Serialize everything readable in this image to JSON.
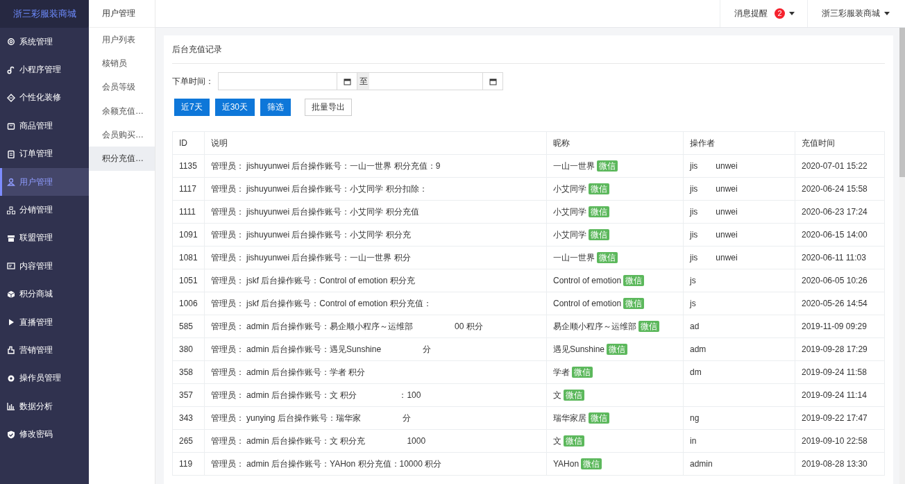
{
  "brand": "浙三彩服装商城",
  "sidebar": {
    "items": [
      {
        "label": "系统管理",
        "selected": false
      },
      {
        "label": "小程序管理",
        "selected": false
      },
      {
        "label": "个性化装修",
        "selected": false
      },
      {
        "label": "商品管理",
        "selected": false
      },
      {
        "label": "订单管理",
        "selected": false
      },
      {
        "label": "用户管理",
        "selected": true
      },
      {
        "label": "分销管理",
        "selected": false
      },
      {
        "label": "联盟管理",
        "selected": false
      },
      {
        "label": "内容管理",
        "selected": false
      },
      {
        "label": "积分商城",
        "selected": false
      },
      {
        "label": "直播管理",
        "selected": false
      },
      {
        "label": "营销管理",
        "selected": false
      },
      {
        "label": "操作员管理",
        "selected": false
      },
      {
        "label": "数据分析",
        "selected": false
      },
      {
        "label": "修改密码",
        "selected": false
      }
    ]
  },
  "submenu": {
    "title": "用户管理",
    "items": [
      {
        "label": "用户列表",
        "selected": false
      },
      {
        "label": "核销员",
        "selected": false
      },
      {
        "label": "会员等级",
        "selected": false
      },
      {
        "label": "余额充值…",
        "selected": false
      },
      {
        "label": "会员购买…",
        "selected": false
      },
      {
        "label": "积分充值…",
        "selected": true
      }
    ]
  },
  "topbar": {
    "notifications": {
      "label": "消息提醒",
      "count": "2"
    },
    "account": "浙三彩服装商城"
  },
  "card": {
    "title": "后台充值记录",
    "filter": {
      "label": "下单时间：",
      "separator": "至",
      "buttons": [
        {
          "label": "近7天",
          "kind": "primary"
        },
        {
          "label": "近30天",
          "kind": "primary"
        },
        {
          "label": "筛选",
          "kind": "primary"
        },
        {
          "label": "批量导出",
          "kind": "default"
        }
      ]
    },
    "table": {
      "columns": [
        "ID",
        "说明",
        "昵称",
        "操作者",
        "充值时间"
      ],
      "rows": [
        {
          "id": "1135",
          "desc": "管理员： jishuyunwei 后台操作账号：一山一世界 积分充值：9",
          "nickname": "一山一世界",
          "tag": "微信",
          "operator": [
            "jis",
            "unwei"
          ],
          "time": "2020-07-01 15:22"
        },
        {
          "id": "1117",
          "desc": "管理员： jishuyunwei 后台操作账号：小艾同学 积分扣除：",
          "nickname": "小艾同学",
          "tag": "微信",
          "operator": [
            "jis",
            "unwei"
          ],
          "time": "2020-06-24 15:58"
        },
        {
          "id": "1111",
          "desc": "管理员： jishuyunwei 后台操作账号：小艾同学 积分充值",
          "nickname": "小艾同学",
          "tag": "微信",
          "operator": [
            "jis",
            "unwei"
          ],
          "time": "2020-06-23 17:24"
        },
        {
          "id": "1091",
          "desc": "管理员： jishuyunwei 后台操作账号：小艾同学 积分充",
          "nickname": "小艾同学",
          "tag": "微信",
          "operator": [
            "jis",
            "unwei"
          ],
          "time": "2020-06-15 14:00"
        },
        {
          "id": "1081",
          "desc": "管理员： jishuyunwei 后台操作账号：一山一世界 积分",
          "nickname": "一山一世界",
          "tag": "微信",
          "operator": [
            "jis",
            "unwei"
          ],
          "time": "2020-06-11 11:03"
        },
        {
          "id": "1051",
          "desc": "管理员： jskf 后台操作账号：Control of emotion 积分充",
          "nickname": "Control of emotion",
          "tag": "微信",
          "operator": [
            "js"
          ],
          "time": "2020-06-05 10:26"
        },
        {
          "id": "1006",
          "desc": "管理员： jskf 后台操作账号：Control of emotion 积分充值：",
          "nickname": "Control of emotion",
          "tag": "微信",
          "operator": [
            "js"
          ],
          "time": "2020-05-26 14:54"
        },
        {
          "id": "585",
          "desc": "管理员： admin 后台操作账号：易企顺小程序～运维部",
          "desc_tail": "00 积分",
          "nickname": "易企顺小程序～运维部",
          "tag": "微信",
          "operator": [
            "ad"
          ],
          "time": "2019-11-09 09:29"
        },
        {
          "id": "380",
          "desc": "管理员： admin 后台操作账号：遇见Sunshine",
          "desc_tail": "分",
          "nickname": "遇见Sunshine",
          "tag": "微信",
          "operator": [
            "adm"
          ],
          "time": "2019-09-28 17:29"
        },
        {
          "id": "358",
          "desc": "管理员： admin 后台操作账号：学者 积分",
          "nickname": "学者",
          "tag": "微信",
          "operator": [
            "dm"
          ],
          "time": "2019-09-24 11:58"
        },
        {
          "id": "357",
          "desc": "管理员： admin 后台操作账号：文 积分",
          "desc_tail": "：100",
          "nickname": "文",
          "tag": "微信",
          "operator": [],
          "time": "2019-09-24 11:14"
        },
        {
          "id": "343",
          "desc": "管理员： yunying 后台操作账号：瑞华家",
          "desc_tail": "分",
          "nickname": "瑞华家居",
          "tag": "微信",
          "operator": [
            "ng"
          ],
          "time": "2019-09-22 17:47"
        },
        {
          "id": "265",
          "desc": "管理员： admin 后台操作账号：文 积分充",
          "desc_tail": "1000",
          "nickname": "文",
          "tag": "微信",
          "operator": [
            "in"
          ],
          "time": "2019-09-10 22:58"
        },
        {
          "id": "119",
          "desc": "管理员： admin 后台操作账号：YAHon 积分充值：10000 积分",
          "nickname": "YAHon",
          "tag": "微信",
          "operator": [
            "admin"
          ],
          "time": "2019-08-28 13:30"
        }
      ]
    }
  }
}
